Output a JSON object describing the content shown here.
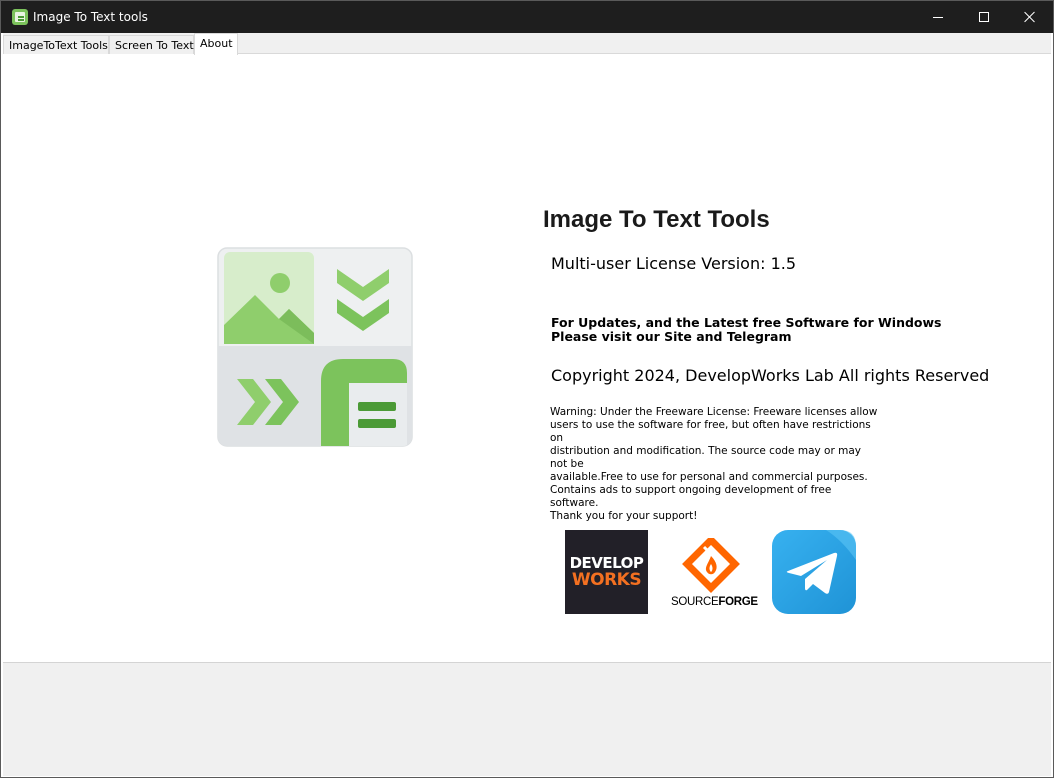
{
  "window": {
    "title": "Image To Text tools",
    "controls": {
      "minimize": "minimize",
      "maximize": "maximize",
      "close": "close"
    }
  },
  "tabs": [
    {
      "label": "ImageToText Tools",
      "active": false
    },
    {
      "label": "Screen To Text",
      "active": false
    },
    {
      "label": "About",
      "active": true
    }
  ],
  "about": {
    "app_name": "Image To Text Tools",
    "version_line": "Multi-user License Version: 1.5",
    "updates_line1": "For Updates, and the Latest free Software for Windows",
    "updates_line2": "Please visit our Site and Telegram",
    "copyright": "Copyright 2024, DevelopWorks Lab All rights Reserved",
    "warning_lines": [
      "Warning: Under the Freeware License: Freeware licenses allow",
      "users to use the software for free, but often have restrictions on",
      "distribution and modification. The source code may or may not be",
      "available.Free to use for personal and commercial purposes.",
      "Contains ads to support ongoing development of free software.",
      "Thank you for your support!"
    ]
  },
  "links": {
    "developworks": {
      "line1": "DEVELOP",
      "line2": "WORKS"
    },
    "sourceforge": {
      "text_light": "SOURCE",
      "text_bold": "FORGE"
    },
    "telegram": {
      "icon": "telegram-icon"
    }
  },
  "colors": {
    "titlebar": "#1e1e1e",
    "accent_green": "#7cc35c",
    "developworks_orange": "#f37021",
    "sourceforge_orange": "#ff6600",
    "telegram_blue": "#29a9eb"
  }
}
